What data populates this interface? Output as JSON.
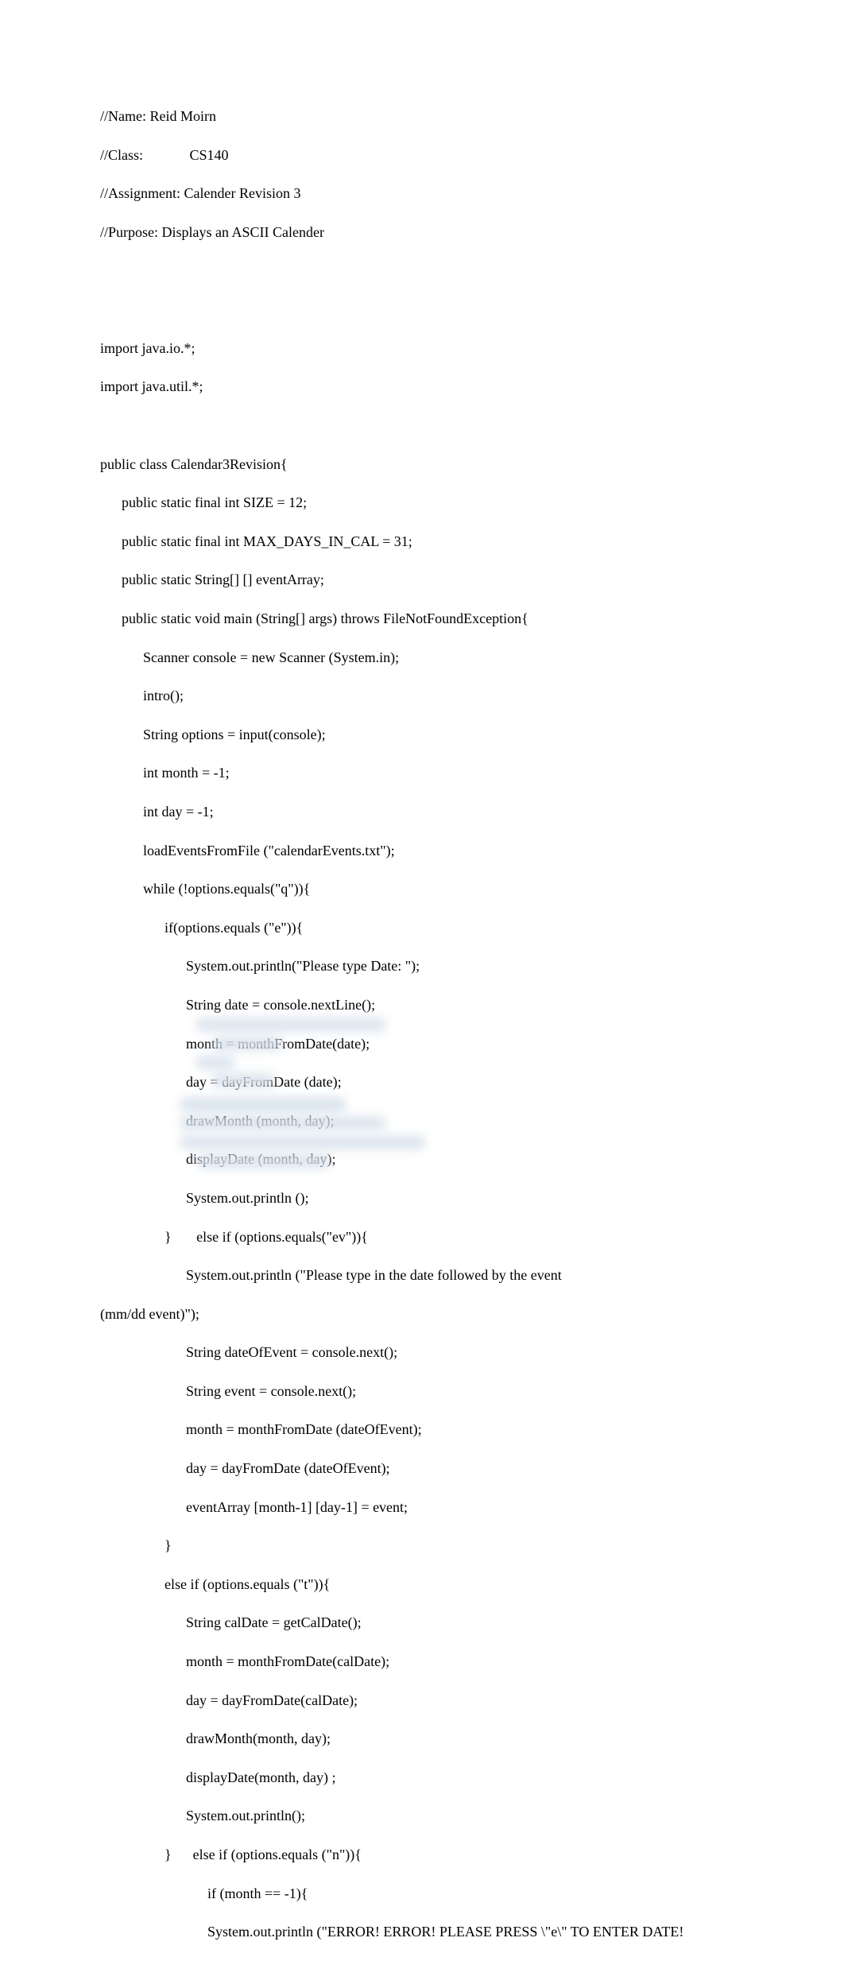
{
  "header": {
    "name_line": "//Name: Reid Moirn",
    "class_line": "//Class:             CS140",
    "assignment_line": "//Assignment: Calender Revision 3",
    "purpose_line": "//Purpose: Displays an ASCII Calender"
  },
  "imports": {
    "io": "import java.io.*;",
    "util": "import java.util.*;"
  },
  "code": {
    "class_decl": "public class Calendar3Revision{",
    "size_decl": "      public static final int SIZE = 12;",
    "maxdays_decl": "      public static final int MAX_DAYS_IN_CAL = 31;",
    "eventarr_decl": "      public static String[] [] eventArray;",
    "main_decl": "      public static void main (String[] args) throws FileNotFoundException{",
    "scanner": "            Scanner console = new Scanner (System.in);",
    "intro": "            intro();",
    "options_assign": "            String options = input(console);",
    "month_init": "            int month = -1;",
    "day_init": "            int day = -1;",
    "load": "            loadEventsFromFile (\"calendarEvents.txt\");",
    "while": "            while (!options.equals(\"q\")){",
    "if_e": "                  if(options.equals (\"e\")){",
    "e_print": "                        System.out.println(\"Please type Date: \");",
    "e_date": "                        String date = console.nextLine();",
    "e_month": "                        month = monthFromDate(date);",
    "e_day": "                        day = dayFromDate (date);",
    "e_draw": "                        drawMonth (month, day);",
    "e_display": "                        displayDate (month, day);",
    "e_println": "                        System.out.println ();",
    "elseif_ev": "                  }       else if (options.equals(\"ev\")){",
    "ev_print": "                        System.out.println (\"Please type in the date followed by the event",
    "ev_print_wrap": "(mm/dd event)\");",
    "ev_dateof": "                        String dateOfEvent = console.next();",
    "ev_event": "                        String event = console.next();",
    "ev_month": "                        month = monthFromDate (dateOfEvent);",
    "ev_day": "                        day = dayFromDate (dateOfEvent);",
    "ev_arr": "                        eventArray [month-1] [day-1] = event;",
    "ev_close": "                  }",
    "elseif_t": "                  else if (options.equals (\"t\")){",
    "t_caldate": "                        String calDate = getCalDate();",
    "t_month": "                        month = monthFromDate(calDate);",
    "t_day": "                        day = dayFromDate(calDate);",
    "t_draw": "                        drawMonth(month, day);",
    "t_display": "                        displayDate(month, day) ;",
    "t_println": "                        System.out.println();",
    "elseif_n": "                  }      else if (options.equals (\"n\")){",
    "n_if": "                              if (month == -1){",
    "n_err": "                              System.out.println (\"ERROR! ERROR! PLEASE PRESS \\\"e\\\" TO ENTER DATE!"
  }
}
